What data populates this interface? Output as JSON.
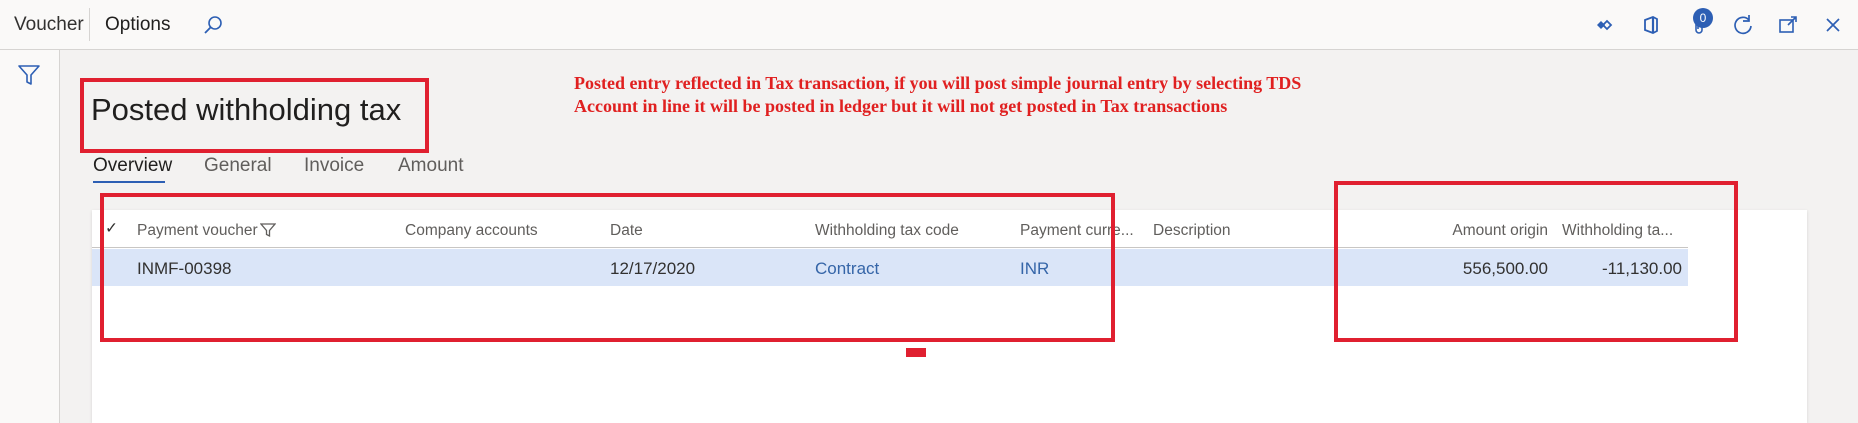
{
  "topbar": {
    "voucher_label": "Voucher",
    "options_label": "Options",
    "icons": [
      "search-icon",
      "connected-icon",
      "office-icon",
      "attachments-icon",
      "refresh-icon",
      "open-new-window-icon",
      "close-icon"
    ],
    "attachments_count": "0"
  },
  "page": {
    "title": "Posted withholding tax"
  },
  "annotation": {
    "text": "Posted entry reflected in Tax transaction, if you will post simple journal entry by selecting TDS Account in line it will be posted in ledger but it will not get posted in Tax transactions"
  },
  "tabs": [
    {
      "label": "Overview",
      "active": true
    },
    {
      "label": "General",
      "active": false
    },
    {
      "label": "Invoice",
      "active": false
    },
    {
      "label": "Amount",
      "active": false
    }
  ],
  "grid": {
    "check_glyph": "✓",
    "columns": [
      "Payment voucher",
      "Company accounts",
      "Date",
      "Withholding tax code",
      "Payment curre...",
      "Description",
      "Amount origin",
      "Withholding ta..."
    ],
    "rows": [
      {
        "payment_voucher": "INMF-00398",
        "company_accounts": "",
        "date": "12/17/2020",
        "withholding_tax_code": "Contract",
        "payment_currency": "INR",
        "description": "",
        "amount_origin": "556,500.00",
        "withholding_tax": "-11,130.00"
      }
    ]
  },
  "colors": {
    "accent": "#2d5fb4",
    "annotation_red": "#e02030",
    "selected_row": "#dae5f8"
  }
}
